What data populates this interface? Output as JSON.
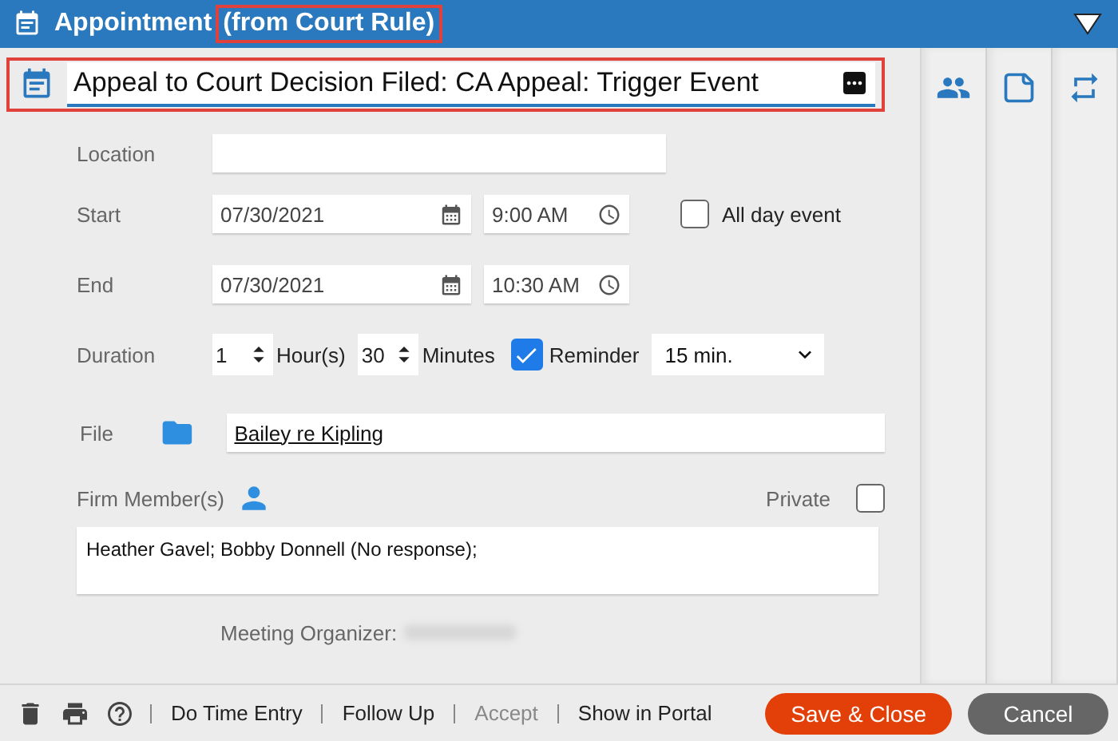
{
  "header": {
    "title": "Appointment",
    "subtitle": "(from Court Rule)",
    "subtitle_highlighted": true
  },
  "subject": {
    "value": "Appeal to Court Decision Filed: CA Appeal: Trigger Event",
    "highlighted": true
  },
  "location": {
    "label": "Location"
  },
  "start": {
    "label": "Start",
    "date": "07/30/2021",
    "time": "9:00 AM",
    "all_day": {
      "label": "All day event",
      "checked": false
    }
  },
  "end": {
    "label": "End",
    "date": "07/30/2021",
    "time": "10:30 AM"
  },
  "duration": {
    "label": "Duration",
    "hours": "1",
    "hours_unit": "Hour(s)",
    "minutes": "30",
    "minutes_unit": "Minutes",
    "reminder": {
      "label": "Reminder",
      "checked": true,
      "value": "15 min."
    }
  },
  "file": {
    "label": "File",
    "value": "Bailey re Kipling"
  },
  "firm_members": {
    "label": "Firm Member(s)",
    "value": "Heather Gavel; Bobby Donnell (No response);",
    "private": {
      "label": "Private",
      "checked": false
    }
  },
  "organizer": {
    "label": "Meeting Organizer:"
  },
  "side_tabs": [
    {
      "kind": "people"
    },
    {
      "kind": "note"
    },
    {
      "kind": "repeat"
    }
  ],
  "footer": {
    "tools": [
      {
        "kind": "delete"
      },
      {
        "kind": "print"
      },
      {
        "kind": "help"
      }
    ],
    "links": [
      {
        "label": "Do Time Entry",
        "disabled": false
      },
      {
        "label": "Follow Up",
        "disabled": false
      },
      {
        "label": "Accept",
        "disabled": true
      },
      {
        "label": "Show in Portal",
        "disabled": false
      }
    ],
    "buttons": [
      {
        "label": "Save & Close",
        "kind": "primary"
      },
      {
        "label": "Cancel",
        "kind": "secondary"
      }
    ]
  }
}
